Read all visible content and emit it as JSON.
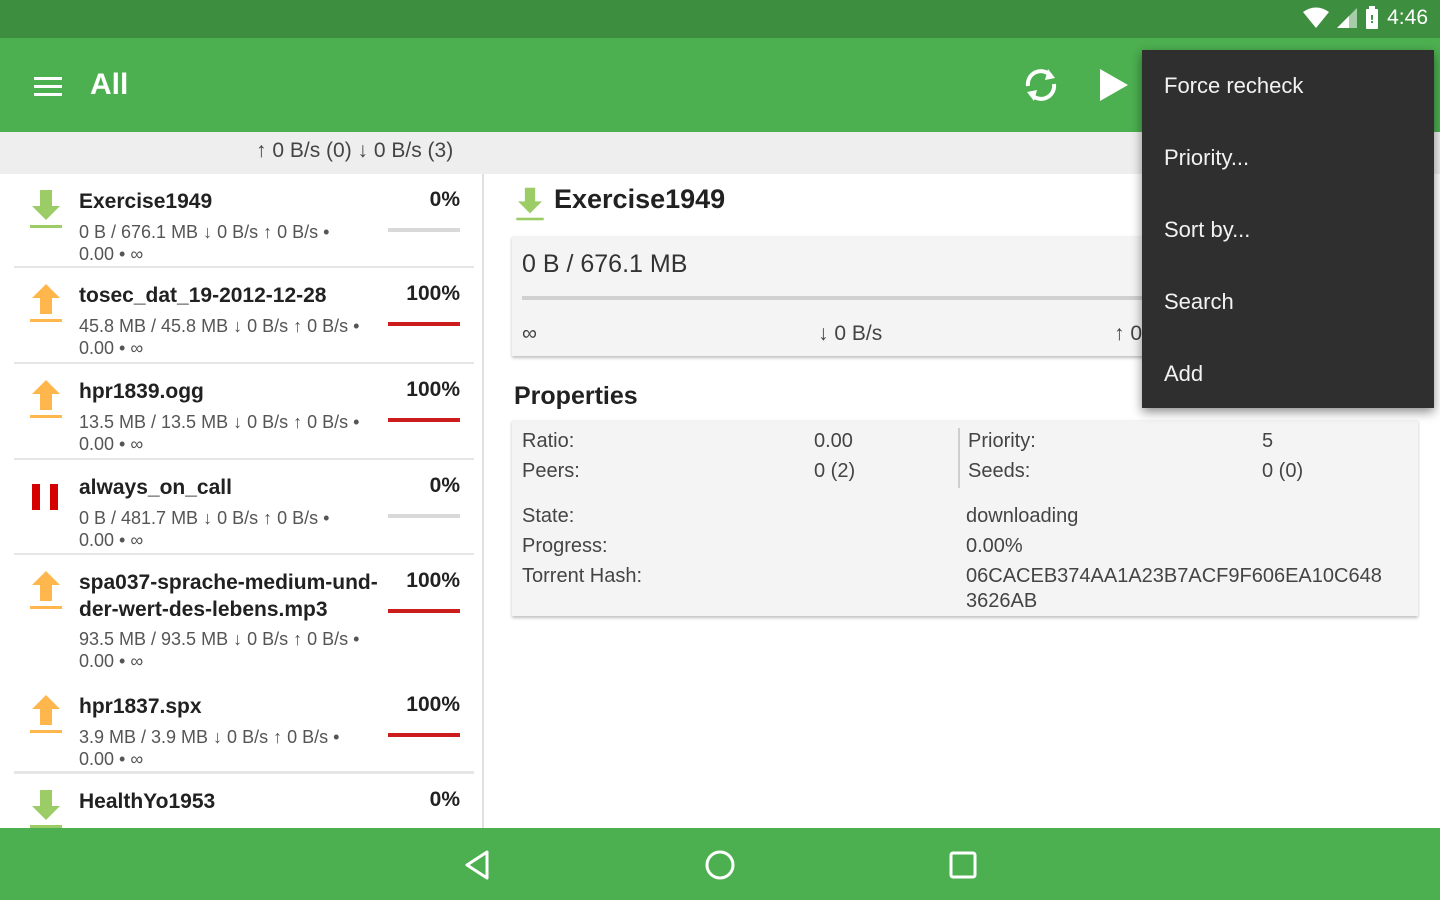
{
  "status": {
    "time": "4:46"
  },
  "toolbar": {
    "title": "All"
  },
  "speed": {
    "text": "↑ 0 B/s (0) ↓ 0 B/s (3)"
  },
  "torrents": [
    {
      "name": "Exercise1949",
      "percent": "0%",
      "progress": 0.0,
      "line1": "0 B / 676.1 MB ↓ 0 B/s ↑ 0 B/s •",
      "line2": "0.00 • ∞",
      "icon": "download-arrow-icon",
      "icon_color": "#9ccc65"
    },
    {
      "name": "tosec_dat_19-2012-12-28",
      "percent": "100%",
      "progress": 1.0,
      "line1": "45.8 MB / 45.8 MB ↓ 0 B/s ↑ 0 B/s •",
      "line2": "0.00 • ∞",
      "icon": "upload-arrow-icon",
      "icon_color": "#ffb74d"
    },
    {
      "name": "hpr1839.ogg",
      "percent": "100%",
      "progress": 1.0,
      "line1": "13.5 MB / 13.5 MB ↓ 0 B/s ↑ 0 B/s •",
      "line2": "0.00 • ∞",
      "icon": "upload-arrow-icon",
      "icon_color": "#ffb74d"
    },
    {
      "name": "always_on_call",
      "percent": "0%",
      "progress": 0.0,
      "line1": "0 B / 481.7 MB ↓ 0 B/s ↑ 0 B/s •",
      "line2": "0.00 • ∞",
      "icon": "pause-icon",
      "icon_color": "#d50000"
    },
    {
      "name": "spa037-sprache-medium-und-der-wert-des-lebens.mp3",
      "percent": "100%",
      "progress": 1.0,
      "line1": "93.5 MB / 93.5 MB ↓ 0 B/s ↑ 0 B/s •",
      "line2": "0.00 • ∞",
      "icon": "upload-arrow-icon",
      "icon_color": "#ffb74d"
    },
    {
      "name": "hpr1837.spx",
      "percent": "100%",
      "progress": 1.0,
      "line1": "3.9 MB / 3.9 MB ↓ 0 B/s ↑ 0 B/s •",
      "line2": "0.00 • ∞",
      "icon": "upload-arrow-icon",
      "icon_color": "#ffb74d"
    },
    {
      "name": "HealthYo1953",
      "percent": "0%",
      "progress": 0.0,
      "line1": "",
      "line2": "",
      "icon": "download-arrow-icon",
      "icon_color": "#9ccc65"
    }
  ],
  "detail": {
    "title": "Exercise1949",
    "size": "0 B / 676.1 MB",
    "progress": 0.0,
    "eta": "∞",
    "down_speed": "↓ 0 B/s",
    "up_speed": "↑ 0",
    "properties_title": "Properties",
    "ratio_label": "Ratio:",
    "ratio": "0.00",
    "peers_label": "Peers:",
    "peers": "0 (2)",
    "priority_label": "Priority:",
    "priority": "5",
    "seeds_label": "Seeds:",
    "seeds": "0 (0)",
    "state_label": "State:",
    "state": "downloading",
    "progress_label": "Progress:",
    "progress_text": "0.00%",
    "hash_label": "Torrent Hash:",
    "hash_line1": "06CACEB374AA1A23B7ACF9F606EA10C648",
    "hash_line2": "3626AB"
  },
  "menu": {
    "items": [
      "Force recheck",
      "Priority...",
      "Sort by...",
      "Search",
      "Add"
    ]
  },
  "colors": {
    "accent": "#4caf50",
    "status_bar": "#3d8f3f",
    "complete_bar": "#cc1d1d",
    "menu_bg": "#2f2f2f"
  }
}
